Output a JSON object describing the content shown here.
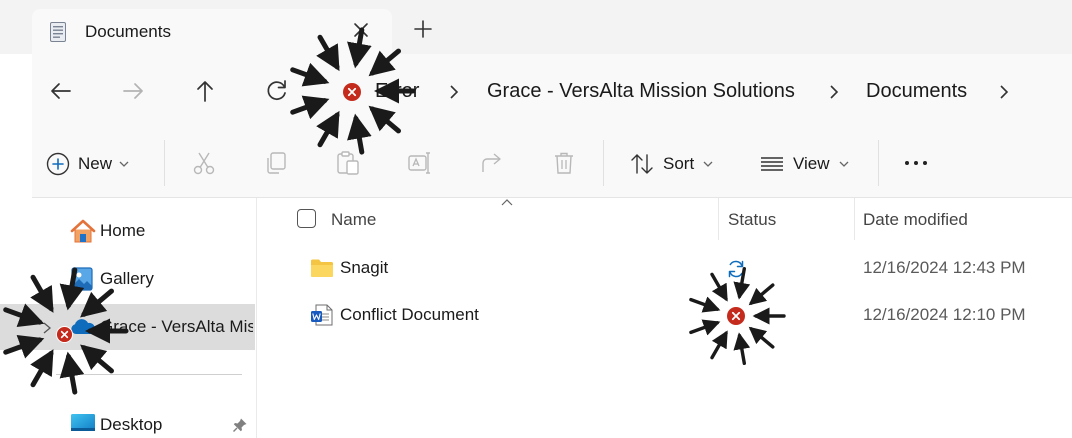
{
  "tab": {
    "title": "Documents"
  },
  "address": {
    "error_label": "Error",
    "crumbs": [
      "Grace - VersAlta Mission Solutions",
      "Documents"
    ]
  },
  "commands": {
    "new_label": "New",
    "sort_label": "Sort",
    "view_label": "View"
  },
  "sidebar": {
    "items": [
      {
        "label": "Home",
        "icon": "home-icon"
      },
      {
        "label": "Gallery",
        "icon": "gallery-icon"
      },
      {
        "label": "Grace - VersAlta Mission Solutions",
        "icon": "onedrive-cloud-icon",
        "selected": true,
        "status": "error"
      },
      {
        "label": "Desktop",
        "icon": "desktop-icon",
        "pinned": true
      }
    ]
  },
  "columns": {
    "name": "Name",
    "status": "Status",
    "date": "Date modified"
  },
  "files": [
    {
      "name": "Snagit",
      "type": "folder",
      "status": "sync-pending",
      "date": "12/16/2024 12:43 PM"
    },
    {
      "name": "Conflict Document",
      "type": "word-document",
      "status": "error",
      "date": "12/16/2024 12:10 PM"
    }
  ],
  "colors": {
    "error": "#c42b1c",
    "onedrive": "#0f6cbd",
    "folder": "#f4c542",
    "selected": "#dcdcdc"
  }
}
